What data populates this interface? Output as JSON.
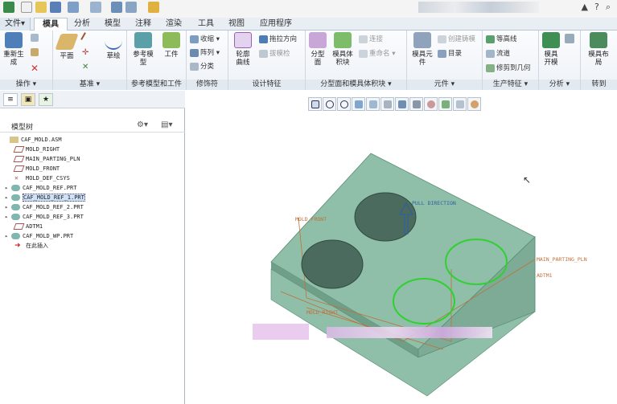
{
  "qat": {
    "icons": [
      "new-icon",
      "open-icon",
      "save-icon",
      "undo-icon",
      "redo-icon",
      "regenerate-icon",
      "windows-icon",
      "close-icon"
    ]
  },
  "window": {
    "controls": [
      "▲",
      "?"
    ]
  },
  "tabs": [
    {
      "label": "文件▾",
      "active": false
    },
    {
      "label": "模具",
      "active": true
    },
    {
      "label": "分析",
      "active": false
    },
    {
      "label": "模型",
      "active": false
    },
    {
      "label": "注释",
      "active": false
    },
    {
      "label": "渲染",
      "active": false
    },
    {
      "label": "工具",
      "active": false
    },
    {
      "label": "视图",
      "active": false
    },
    {
      "label": "应用程序",
      "active": false
    }
  ],
  "ribbon": {
    "groups": [
      "操作 ▾",
      "基准 ▾",
      "参考模型和工件",
      "修饰符",
      "设计特征",
      "分型面和模具体积块 ▾",
      "元件 ▾",
      "生产特征 ▾",
      "分析 ▾",
      "转到"
    ],
    "regenerate": "重新生成",
    "plane": "平面",
    "sketch": "草绘",
    "ref_model": "参考模型",
    "workpiece": "工件",
    "shrink": "收缩 ▾",
    "pattern": "阵列 ▾",
    "classify": "分类",
    "silhouette": "轮廓曲线",
    "draw_dir": "拖拉方向",
    "draft_check": "拔模检",
    "link": "连接",
    "rename": "重命名 ▾",
    "parting_surface": "分型面",
    "mold_volume": "模具体积块",
    "mold_component": "模具元件",
    "create_casting": "创建铸模",
    "catalog": "目录",
    "isoline": "等高线",
    "runner": "流道",
    "trim_to_geom": "修剪到几何",
    "mold_open": "模具开模",
    "mold_layout": "模具布局"
  },
  "model_tree": {
    "title": "模型树",
    "items": [
      {
        "label": "CAF_MOLD.ASM",
        "expand": ""
      },
      {
        "label": "MOLD_RIGHT",
        "expand": ""
      },
      {
        "label": "MAIN_PARTING_PLN",
        "expand": ""
      },
      {
        "label": "MOLD_FRONT",
        "expand": ""
      },
      {
        "label": "MOLD_DEF_CSYS",
        "expand": ""
      },
      {
        "label": "CAF_MOLD_REF.PRT",
        "expand": "▸"
      },
      {
        "label": "CAF_MOLD_REF_1.PRT",
        "expand": "▸",
        "selected": true
      },
      {
        "label": "CAF_MOLD_REF_2.PRT",
        "expand": "▸"
      },
      {
        "label": "CAF_MOLD_REF_3.PRT",
        "expand": "▸"
      },
      {
        "label": "ADTM1",
        "expand": ""
      },
      {
        "label": "CAF_MOLD_WP.PRT",
        "expand": "▸"
      },
      {
        "label": "在此插入",
        "expand": ""
      }
    ]
  },
  "viewport": {
    "labels": {
      "pull": "PULL DIRECTION",
      "front": "MOLD_FRONT",
      "parting": "MAIN_PARTING_PLN",
      "adtm": "ADTM1",
      "right": "MOLD_RIGHT"
    }
  },
  "colors": {
    "workpiece": "#8fbfa8",
    "accent": "#2d5fa0",
    "green": "#2fd12f"
  }
}
